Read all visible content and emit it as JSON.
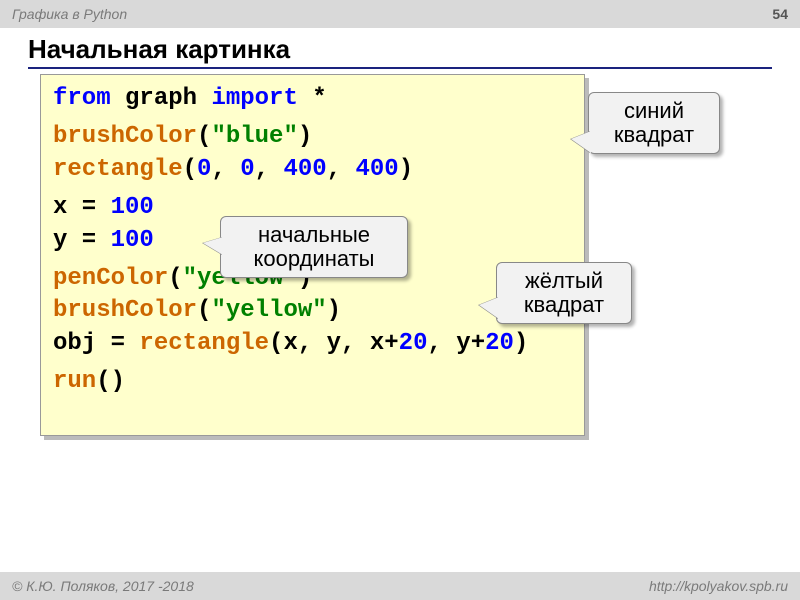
{
  "header": {
    "topic": "Графика в Python",
    "page": "54"
  },
  "title": "Начальная картинка",
  "code": {
    "l1": {
      "from": "from",
      "mod": " graph ",
      "import": "import",
      "star": " *"
    },
    "l2": {
      "fn": "brushColor",
      "open": "(",
      "str": "\"blue\"",
      "close": ")"
    },
    "l3": {
      "fn": "rectangle",
      "open": "(",
      "n1": "0",
      "c1": ", ",
      "n2": "0",
      "c2": ", ",
      "n3": "400",
      "c3": ", ",
      "n4": "400",
      "close": ")"
    },
    "l4": {
      "lhs": "x = ",
      "val": "100"
    },
    "l5": {
      "lhs": "y = ",
      "val": "100"
    },
    "l6": {
      "fn": "penColor",
      "open": "(",
      "str": "\"yellow\"",
      "close": ")"
    },
    "l7": {
      "fn": "brushColor",
      "open": "(",
      "str": "\"yellow\"",
      "close": ")"
    },
    "l8": {
      "lhs": "obj = ",
      "fn": "rectangle",
      "open": "(x, y, x+",
      "n1": "20",
      "mid": ", y+",
      "n2": "20",
      "close": ")"
    },
    "l9": {
      "fn": "run",
      "paren": "()"
    }
  },
  "callouts": {
    "c1a": "синий",
    "c1b": "квадрат",
    "c2a": "начальные",
    "c2b": "координаты",
    "c3a": "жёлтый",
    "c3b": "квадрат"
  },
  "footer": {
    "copyright": "© К.Ю. Поляков, 2017 -2018",
    "url": "http://kpolyakov.spb.ru"
  }
}
